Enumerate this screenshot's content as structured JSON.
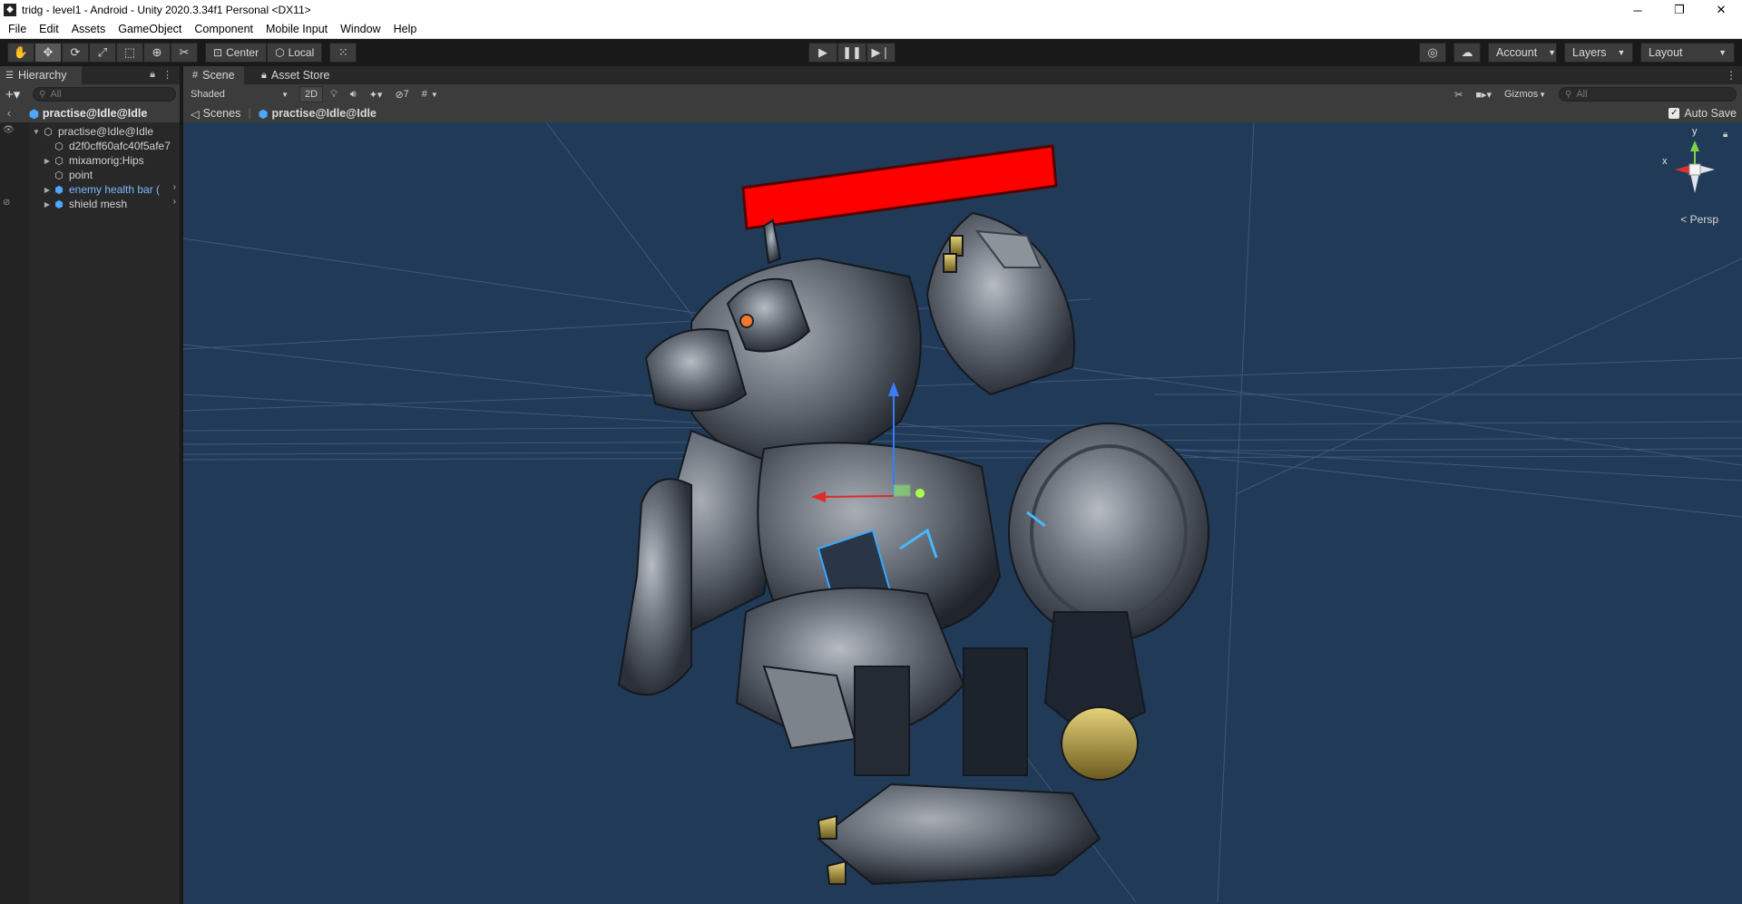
{
  "window": {
    "title": "tridg - level1 - Android - Unity 2020.3.34f1 Personal <DX11>",
    "minimize": "─",
    "maximize": "❐",
    "close": "✕"
  },
  "menu": [
    "File",
    "Edit",
    "Assets",
    "GameObject",
    "Component",
    "Mobile Input",
    "Window",
    "Help"
  ],
  "toolbar": {
    "pivot_label": "Center",
    "space_label": "Local",
    "account_label": "Account",
    "layers_label": "Layers",
    "layout_label": "Layout"
  },
  "hierarchy": {
    "tab_label": "Hierarchy",
    "search_placeholder": "All",
    "scene_name": "practise@Idle@Idle",
    "items": [
      {
        "label": "practise@Idle@Idle",
        "expanded": true
      },
      {
        "label": "d2f0cff60afc40f5afe7"
      },
      {
        "label": "mixamorig:Hips"
      },
      {
        "label": "point"
      },
      {
        "label": "enemy health bar (",
        "prefab": true
      },
      {
        "label": "shield mesh",
        "prefab": true
      }
    ]
  },
  "scene": {
    "tabs": [
      "Scene",
      "Asset Store"
    ],
    "draw_mode": "Shaded",
    "mode_2d": "2D",
    "hidden_count": "7",
    "gizmos_label": "Gizmos",
    "search_placeholder": "All",
    "breadcrumb_root": "Scenes",
    "breadcrumb_prefab": "practise@Idle@Idle",
    "autosave_label": "Auto Save",
    "autosave_checked": true,
    "projection_label": "< Persp",
    "axis_x": "x",
    "axis_y": "y"
  },
  "colors": {
    "viewport_bg": "#213a57",
    "health_bar": "#ff0000",
    "prefab_blue": "#4da6ff"
  },
  "icons": [
    "hand-icon",
    "move-icon",
    "rotate-icon",
    "scale-icon",
    "rect-icon",
    "transform-icon",
    "custom-tool-icon",
    "play-icon",
    "pause-icon",
    "step-icon",
    "collab-icon",
    "cloud-icon",
    "lock-icon",
    "kebab-icon",
    "eye-icon",
    "cube-icon",
    "light-icon",
    "audio-icon",
    "effects-icon",
    "visibility-icon",
    "grid-icon",
    "camera-icon",
    "tools-icon",
    "search-icon"
  ]
}
